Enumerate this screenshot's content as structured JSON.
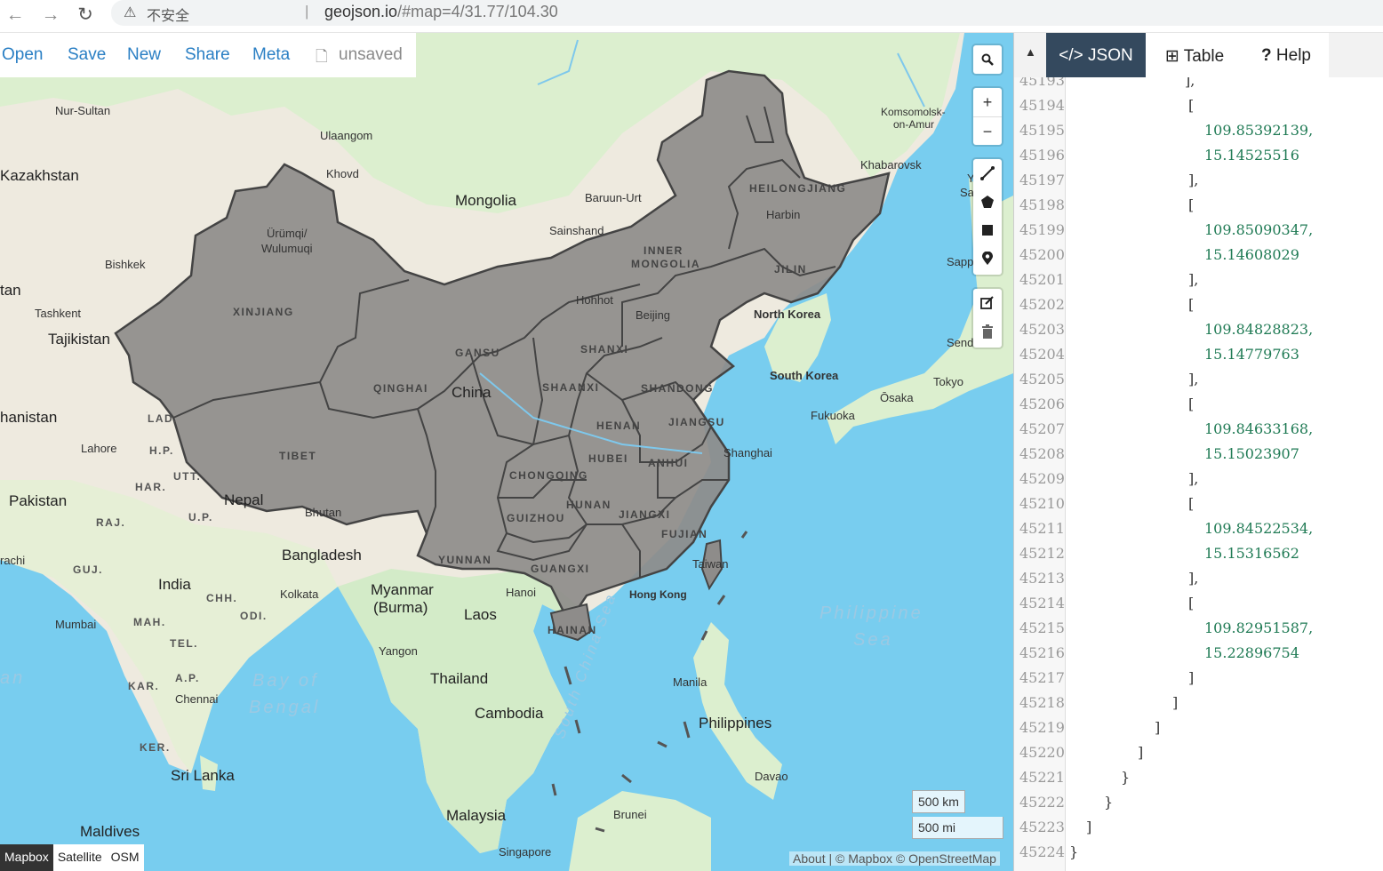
{
  "browser": {
    "back_icon": "arrow-left-icon",
    "forward_icon": "arrow-right-icon",
    "reload_icon": "reload-icon",
    "security_icon": "warning-icon",
    "security_label": "不安全",
    "separator": "|",
    "url_host": "geojson.io",
    "url_path": "/#map=4/31.77/104.30"
  },
  "menu": {
    "open": "Open",
    "save": "Save",
    "new": "New",
    "share": "Share",
    "meta": "Meta",
    "file_status": "unsaved"
  },
  "map_controls": [
    "search-icon",
    "zoom-in-icon",
    "zoom-out-icon",
    "draw-line-icon",
    "draw-polygon-icon",
    "draw-rectangle-icon",
    "draw-marker-icon",
    "edit-icon",
    "delete-icon"
  ],
  "map_labels": {
    "countries": [
      "Mongolia",
      "Kazakhstan",
      "Tajikistan",
      "hanistan",
      "Pakistan",
      "India",
      "Nepal",
      "Bhutan",
      "Bangladesh",
      "Myanmar",
      "(Burma)",
      "Laos",
      "Thailand",
      "Cambodia",
      "Philippines",
      "Malaysia",
      "Brunei",
      "Sri Lanka",
      "Maldives",
      "North Korea",
      "South Korea",
      "China",
      "tan",
      "rachi",
      "an"
    ],
    "cities": [
      "Nur-Sultan",
      "Ulaangom",
      "Khovd",
      "Ürümqi/",
      "Wulumuqi",
      "Bishkek",
      "Tashkent",
      "Baruun-Urt",
      "Sainshand",
      "Hohhot",
      "Beijing",
      "Harbin",
      "Komsomolsk-",
      "on-Amur",
      "Khabarovsk",
      "Sapp",
      "Send",
      "Tokyo",
      "Ōsaka",
      "Fukuoka",
      "Shanghai",
      "Taiwan",
      "Hong Kong",
      "Hanoi",
      "Yangon",
      "Manila",
      "Davao",
      "Kolkata",
      "Lahore",
      "Mumbai",
      "Chennai",
      "Singapore",
      "Sa",
      "Y"
    ],
    "provinces": [
      "XINJIANG",
      "TIBET",
      "QINGHAI",
      "GANSU",
      "INNER",
      "MONGOLIA",
      "HEILONGJIANG",
      "JILIN",
      "SHANXI",
      "SHAANXI",
      "SHANDONG",
      "HENAN",
      "JIANGSU",
      "HUBEI",
      "ANHUI",
      "CHONGQING",
      "HUNAN",
      "GUIZHOU",
      "JIANGXI",
      "FUJIAN",
      "YUNNAN",
      "GUANGXI",
      "HAINAN"
    ],
    "indian_states": [
      "LAD.",
      "H.P.",
      "UTT.",
      "HAR.",
      "RAJ.",
      "U.P.",
      "A.P.",
      "GUJ.",
      "CHH.",
      "ODI.",
      "MAH.",
      "TEL.",
      "KAR.",
      "KER."
    ],
    "water": [
      "Bay of",
      "Bengal",
      "Philippine",
      "Sea",
      "South China Sea"
    ]
  },
  "scale": {
    "km": "500 km",
    "mi": "500 mi"
  },
  "layers": [
    "Mapbox",
    "Satellite",
    "OSM"
  ],
  "attribution": "About | © Mapbox © OpenStreetMap",
  "panel": {
    "collapse_icon": "triangle-up-icon",
    "tabs": [
      {
        "label": "JSON",
        "icon": "code-icon"
      },
      {
        "label": "Table",
        "icon": "table-icon"
      },
      {
        "label": "Help",
        "icon": "question-icon"
      }
    ],
    "lines": [
      {
        "n": "45193",
        "t": "],"
      },
      {
        "n": "45194",
        "t": "["
      },
      {
        "n": "45195",
        "t": "109.85392139,"
      },
      {
        "n": "45196",
        "t": "15.14525516"
      },
      {
        "n": "45197",
        "t": "],"
      },
      {
        "n": "45198",
        "t": "["
      },
      {
        "n": "45199",
        "t": "109.85090347,"
      },
      {
        "n": "45200",
        "t": "15.14608029"
      },
      {
        "n": "45201",
        "t": "],"
      },
      {
        "n": "45202",
        "t": "["
      },
      {
        "n": "45203",
        "t": "109.84828823,"
      },
      {
        "n": "45204",
        "t": "15.14779763"
      },
      {
        "n": "45205",
        "t": "],"
      },
      {
        "n": "45206",
        "t": "["
      },
      {
        "n": "45207",
        "t": "109.84633168,"
      },
      {
        "n": "45208",
        "t": "15.15023907"
      },
      {
        "n": "45209",
        "t": "],"
      },
      {
        "n": "45210",
        "t": "["
      },
      {
        "n": "45211",
        "t": "109.84522534,"
      },
      {
        "n": "45212",
        "t": "15.15316562"
      },
      {
        "n": "45213",
        "t": "],"
      },
      {
        "n": "45214",
        "t": "["
      },
      {
        "n": "45215",
        "t": "109.82951587,"
      },
      {
        "n": "45216",
        "t": "15.22896754"
      },
      {
        "n": "45217",
        "t": "]"
      },
      {
        "n": "45218",
        "t": "]"
      },
      {
        "n": "45219",
        "t": "]"
      },
      {
        "n": "45220",
        "t": "]"
      },
      {
        "n": "45221",
        "t": "}"
      },
      {
        "n": "45222",
        "t": "}"
      },
      {
        "n": "45223",
        "t": "]"
      },
      {
        "n": "45224",
        "t": "}"
      }
    ]
  }
}
